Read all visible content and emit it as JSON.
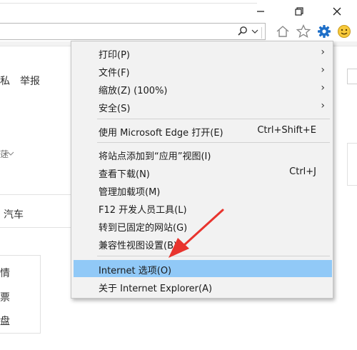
{
  "window": {
    "minimize_icon": "minimize-icon",
    "restore_icon": "restore-icon",
    "close_icon": "close-icon"
  },
  "addressbar": {
    "search_icon": "search-icon",
    "dropdown_icon": "chevron-down-icon",
    "refresh_icon": "refresh-icon"
  },
  "toolbar": {
    "home_icon": "home-icon",
    "favorites_icon": "star-icon",
    "tools_icon": "gear-icon",
    "feedback_icon": "smiley-icon"
  },
  "page": {
    "nav_private": "私",
    "nav_report": "举报",
    "dropdown_fragment": "蒁",
    "nav_cars": "汽车",
    "list_items": [
      "情",
      "票",
      "盘"
    ]
  },
  "menu": {
    "items": [
      {
        "label": "打印(P)",
        "has_submenu": true
      },
      {
        "label": "文件(F)",
        "has_submenu": true
      },
      {
        "label": "缩放(Z) (100%)",
        "has_submenu": true
      },
      {
        "label": "安全(S)",
        "has_submenu": true
      },
      {
        "label": "使用 Microsoft Edge 打开(E)",
        "shortcut": "Ctrl+Shift+E"
      },
      {
        "label": "将站点添加到“应用”视图(I)"
      },
      {
        "label": "查看下载(N)",
        "shortcut": "Ctrl+J"
      },
      {
        "label": "管理加载项(M)"
      },
      {
        "label": "F12 开发人员工具(L)"
      },
      {
        "label": "转到已固定的网站(G)"
      },
      {
        "label": "兼容性视图设置(B)"
      },
      {
        "label": "Internet 选项(O)",
        "highlighted": true
      },
      {
        "label": "关于 Internet Explorer(A)"
      }
    ],
    "highlight_color": "#91c9f7"
  },
  "annotation": {
    "arrow_color": "#e8342e"
  }
}
